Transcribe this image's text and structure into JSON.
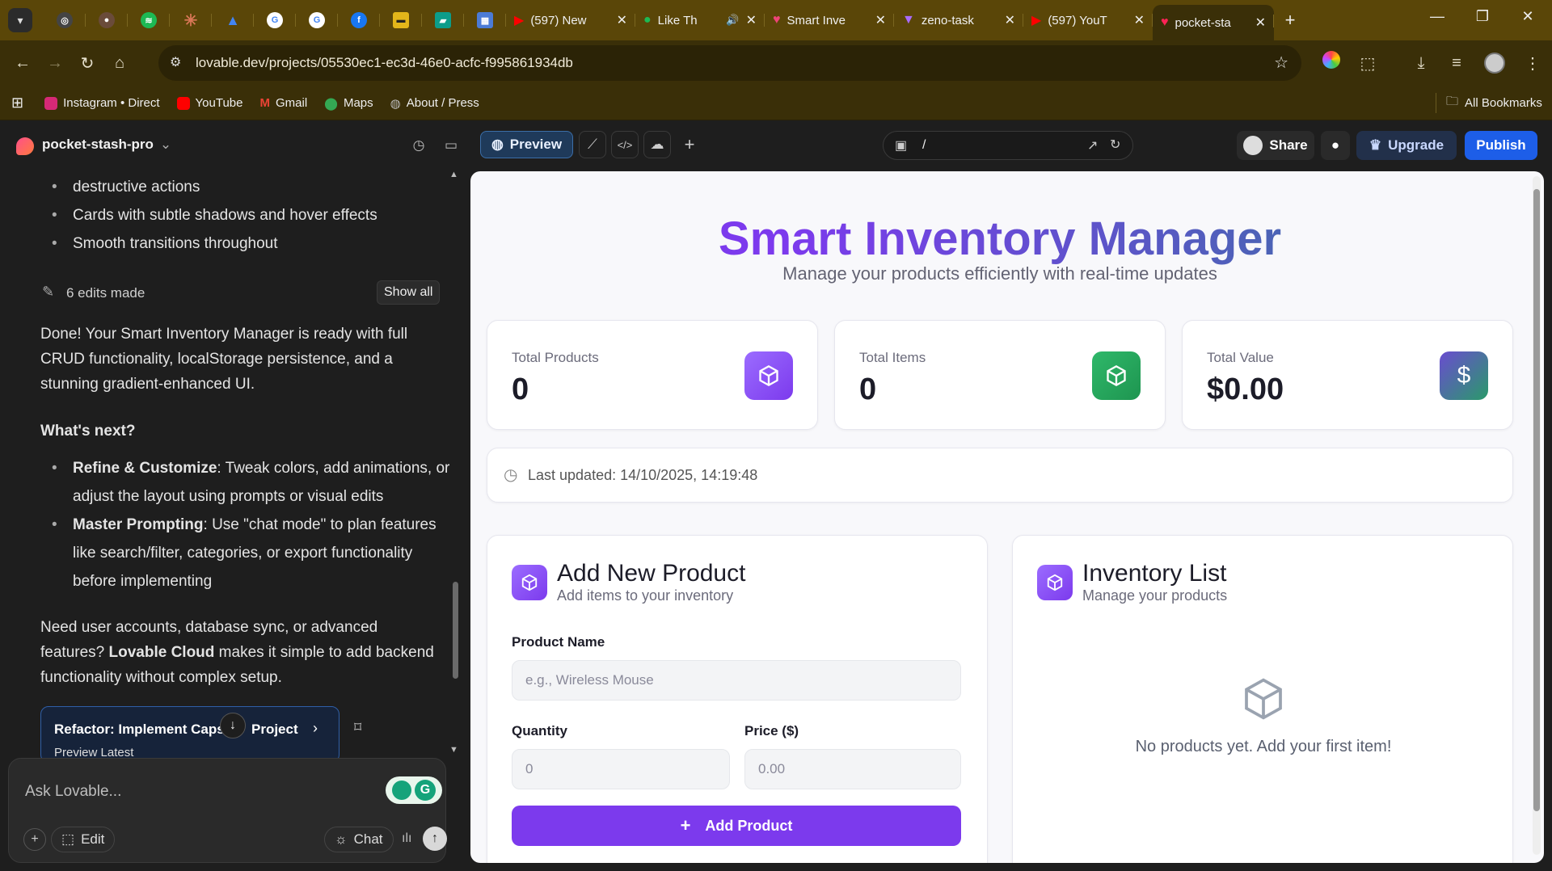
{
  "browser": {
    "tabs": [
      {
        "title": "(597) New",
        "type": "youtube"
      },
      {
        "title": "Like Th",
        "type": "spotify"
      },
      {
        "title": "Smart Inve",
        "type": "lovable-alt"
      },
      {
        "title": "zeno-task",
        "type": "vite"
      },
      {
        "title": "(597) YouT",
        "type": "youtube"
      },
      {
        "title": "pocket-sta",
        "type": "lovable",
        "active": true
      }
    ],
    "url": "lovable.dev/projects/05530ec1-ec3d-46e0-acfc-f995861934db",
    "bookmarks": [
      {
        "label": "Instagram • Direct",
        "color": "#d62976"
      },
      {
        "label": "YouTube",
        "color": "#ff0000"
      },
      {
        "label": "Gmail",
        "color": "#ea4335"
      },
      {
        "label": "Maps",
        "color": "#34a853"
      },
      {
        "label": "About / Press",
        "color": "#9aa0a6"
      }
    ],
    "all_bookmarks": "All Bookmarks"
  },
  "app": {
    "project_name": "pocket-stash-pro",
    "preview_label": "Preview",
    "path": "/",
    "share_label": "Share",
    "upgrade_label": "Upgrade",
    "publish_label": "Publish"
  },
  "chat": {
    "top_bullets": [
      "destructive actions",
      "Cards with subtle shadows and hover effects",
      "Smooth transitions throughout"
    ],
    "edits_made": "6 edits made",
    "show_all": "Show all",
    "done_text": "Done! Your Smart Inventory Manager is ready with full CRUD functionality, localStorage persistence, and a stunning gradient-enhanced UI.",
    "whats_next": "What's next?",
    "next_items": [
      {
        "bold": "Refine & Customize",
        "text": ": Tweak colors, add animations, or adjust the layout using prompts or visual edits"
      },
      {
        "bold": "Master Prompting",
        "text": ": Use \"chat mode\" to plan features like search/filter, categories, or export functionality before implementing"
      }
    ],
    "cloud_pre": "Need user accounts, database sync, or advanced features? ",
    "cloud_bold": "Lovable Cloud",
    "cloud_post": " makes it simple to add backend functionality without complex setup.",
    "commit_title": "Refactor: Implement Caps",
    "commit_title2": "Project",
    "commit_sub": "Preview Latest",
    "input_placeholder": "Ask Lovable...",
    "edit_label": "Edit",
    "chat_label": "Chat"
  },
  "inventory": {
    "title": "Smart Inventory Manager",
    "subtitle": "Manage your products efficiently with real-time updates",
    "stats": [
      {
        "label": "Total Products",
        "value": "0",
        "color": "#8b5cf6",
        "icon": "box-icon"
      },
      {
        "label": "Total Items",
        "value": "0",
        "color": "#22a35a",
        "icon": "box-icon"
      },
      {
        "label": "Total Value",
        "value": "$0.00",
        "color": "#3f6fa0",
        "icon": "dollar-icon"
      }
    ],
    "last_updated": "Last updated: 14/10/2025, 14:19:48",
    "add_title": "Add New Product",
    "add_sub": "Add items to your inventory",
    "product_name_label": "Product Name",
    "product_name_placeholder": "e.g., Wireless Mouse",
    "quantity_label": "Quantity",
    "quantity_placeholder": "0",
    "price_label": "Price ($)",
    "price_placeholder": "0.00",
    "add_button": "Add Product",
    "list_title": "Inventory List",
    "list_sub": "Manage your products",
    "empty_text": "No products yet. Add your first item!"
  }
}
